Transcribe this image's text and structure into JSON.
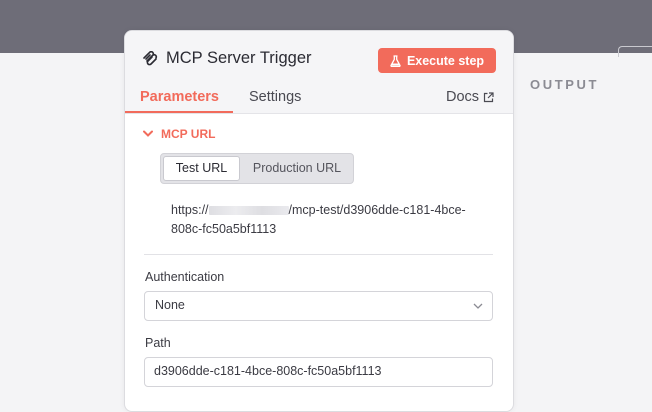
{
  "output": {
    "label": "OUTPUT"
  },
  "node": {
    "title": "MCP Server Trigger",
    "icon": "mcp-icon",
    "execute_label": "Execute step",
    "execute_icon": "flask-icon"
  },
  "tabs": [
    {
      "label": "Parameters",
      "active": true
    },
    {
      "label": "Settings",
      "active": false
    }
  ],
  "docs": {
    "label": "Docs",
    "icon": "external-link-icon"
  },
  "mcp_url": {
    "label": "MCP URL",
    "options": [
      "Test URL",
      "Production URL"
    ],
    "selected": "Test URL",
    "url_prefix": "https://",
    "url_suffix": "/mcp-test/d3906dde-c181-4bce-808c-fc50a5bf1113"
  },
  "authentication": {
    "label": "Authentication",
    "value": "None"
  },
  "path": {
    "label": "Path",
    "value": "d3906dde-c181-4bce-808c-fc50a5bf1113"
  },
  "colors": {
    "accent": "#f26b5b",
    "topbar": "#6e6d78",
    "panel_bg": "#ffffff"
  }
}
